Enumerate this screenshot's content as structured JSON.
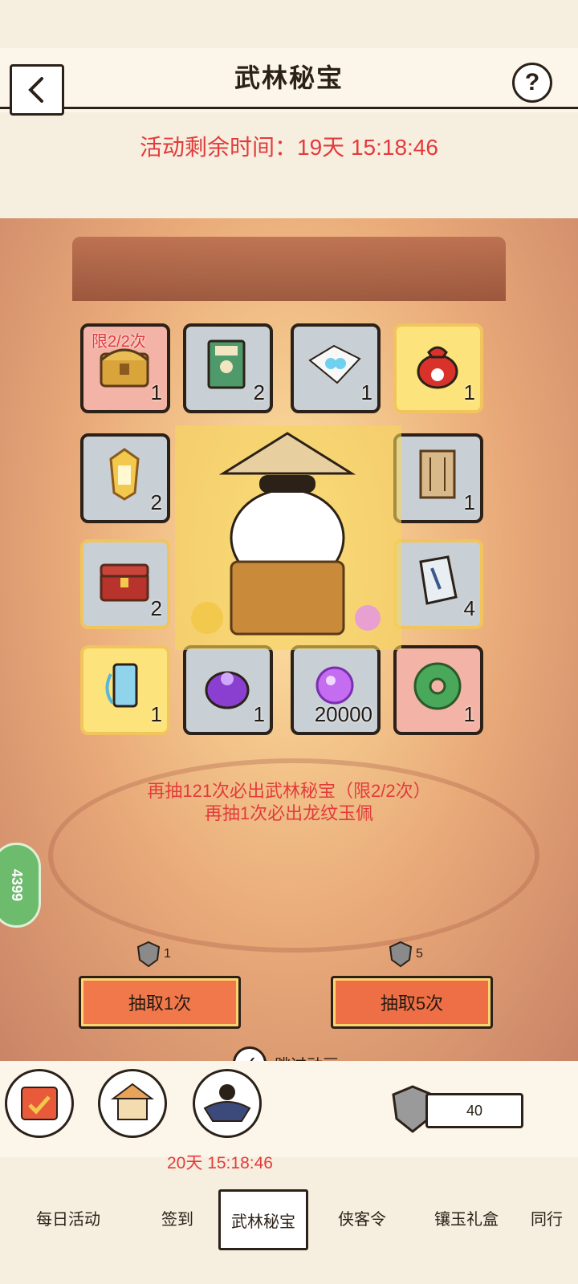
{
  "header": {
    "title": "武林秘宝",
    "back_icon": "chevron-left-icon",
    "help_label": "?"
  },
  "timer_top": "活动剩余时间：19天 15:18:46",
  "grid": {
    "items": [
      {
        "name": "treasure-chest",
        "count": "1",
        "limit": "限2/2次"
      },
      {
        "name": "book-scroll",
        "count": "2"
      },
      {
        "name": "pearl-envelope",
        "count": "1"
      },
      {
        "name": "money-bag",
        "count": "1"
      },
      {
        "name": "gold-token",
        "count": "2"
      },
      {
        "name": "hire-ticket",
        "count": "1"
      },
      {
        "name": "red-chest",
        "count": "2"
      },
      {
        "name": "scroll-paper",
        "count": "4"
      },
      {
        "name": "talisman-tag",
        "count": "1"
      },
      {
        "name": "poison-bag",
        "count": "1"
      },
      {
        "name": "potential-orb",
        "count": "20000"
      },
      {
        "name": "dragon-jade",
        "count": "1"
      }
    ]
  },
  "hints": {
    "line1": "再抽121次必出武林秘宝（限2/2次）",
    "line2": "再抽1次必出龙纹玉佩"
  },
  "draw": {
    "one": {
      "cost": "1",
      "label": "抽取1次"
    },
    "five": {
      "cost": "5",
      "label": "抽取5次"
    }
  },
  "skip_label": "跳过动画",
  "side_badge": "4399",
  "bottom": {
    "timer": "20天 15:18:46",
    "currency_value": "40",
    "icons": [
      "calendar-icon",
      "shop-icon",
      "hero-portrait-icon"
    ]
  },
  "tabs": [
    {
      "label": "每日活动",
      "active": false
    },
    {
      "label": "签到",
      "active": false
    },
    {
      "label": "武林秘宝",
      "active": true
    },
    {
      "label": "侠客令",
      "active": false
    },
    {
      "label": "镶玉礼盒",
      "active": false
    },
    {
      "label": "同行",
      "active": false
    }
  ],
  "colors": {
    "accent_red": "#e33b3b",
    "button_orange": "#f0784b",
    "slot_gray": "#c8d0d6",
    "slot_gold": "#fde37b",
    "slot_red": "#f3b3a6"
  }
}
